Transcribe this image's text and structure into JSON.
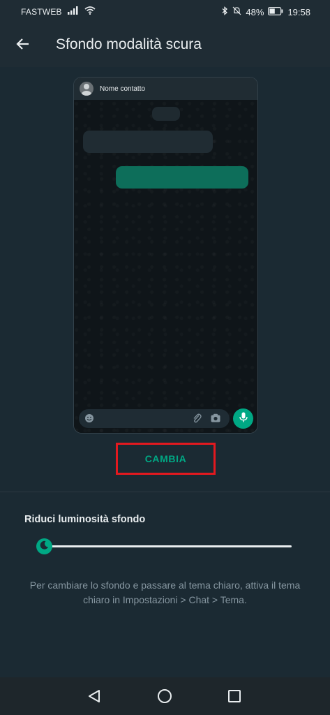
{
  "status_bar": {
    "carrier": "FASTWEB",
    "battery": "48%",
    "time": "19:58"
  },
  "header": {
    "title": "Sfondo modalità scura",
    "back_icon": "arrow-back-icon"
  },
  "preview": {
    "contact_name": "Nome contatto",
    "icons": [
      "emoji-icon",
      "paperclip-icon",
      "camera-icon",
      "mic-icon"
    ]
  },
  "change_button_label": "CAMBIA",
  "dimming": {
    "label": "Riduci luminosità sfondo",
    "slider_value": 0
  },
  "info_text": "Per cambiare lo sfondo e passare al tema chiaro, attiva il tema chiaro in Impostazioni > Chat > Tema.",
  "colors": {
    "accent": "#00a884",
    "background": "#1b2a33",
    "highlight_border": "#e3191f"
  }
}
